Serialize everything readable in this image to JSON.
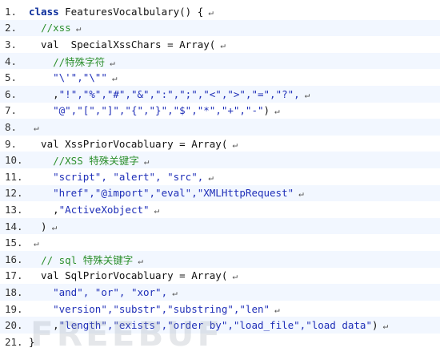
{
  "watermark": "FREEBUF",
  "return_glyph": "↵",
  "lines": [
    {
      "num": "1.",
      "tokens": [
        {
          "t": "kw",
          "v": "class "
        },
        {
          "t": "txt",
          "v": "FeaturesVocalbulary() {"
        }
      ]
    },
    {
      "num": "2.",
      "tokens": [
        {
          "t": "txt",
          "v": "  "
        },
        {
          "t": "cmt",
          "v": "//xss"
        }
      ]
    },
    {
      "num": "3.",
      "tokens": [
        {
          "t": "txt",
          "v": "  val  SpecialXssChars = Array("
        }
      ]
    },
    {
      "num": "4.",
      "tokens": [
        {
          "t": "txt",
          "v": "    "
        },
        {
          "t": "cmt",
          "v": "//特殊字符"
        }
      ]
    },
    {
      "num": "5.",
      "tokens": [
        {
          "t": "txt",
          "v": "    "
        },
        {
          "t": "str",
          "v": "\"\\'\",\"\\\"\""
        }
      ]
    },
    {
      "num": "6.",
      "tokens": [
        {
          "t": "txt",
          "v": "    ,"
        },
        {
          "t": "str",
          "v": "\"!\",\"%\",\"#\",\"&\",\":\",\";\",\"<\",\">\",\"=\",\"?\","
        }
      ]
    },
    {
      "num": "7.",
      "tokens": [
        {
          "t": "txt",
          "v": "    "
        },
        {
          "t": "str",
          "v": "\"@\",\"[\",\"]\",\"{\",\"}\",\"$\",\"*\",\"+\",\"-\""
        },
        {
          "t": "txt",
          "v": ")"
        }
      ]
    },
    {
      "num": "8.",
      "tokens": []
    },
    {
      "num": "9.",
      "tokens": [
        {
          "t": "txt",
          "v": "  val XssPriorVocabluary = Array("
        }
      ]
    },
    {
      "num": "10.",
      "tokens": [
        {
          "t": "txt",
          "v": "    "
        },
        {
          "t": "cmt",
          "v": "//XSS 特殊关键字"
        }
      ]
    },
    {
      "num": "11.",
      "tokens": [
        {
          "t": "txt",
          "v": "    "
        },
        {
          "t": "str",
          "v": "\"script\", \"alert\", \"src\","
        }
      ]
    },
    {
      "num": "12.",
      "tokens": [
        {
          "t": "txt",
          "v": "    "
        },
        {
          "t": "str",
          "v": "\"href\",\"@import\",\"eval\",\"XMLHttpRequest\""
        }
      ]
    },
    {
      "num": "13.",
      "tokens": [
        {
          "t": "txt",
          "v": "    ,"
        },
        {
          "t": "str",
          "v": "\"ActiveXobject\""
        }
      ]
    },
    {
      "num": "14.",
      "tokens": [
        {
          "t": "txt",
          "v": "  )"
        }
      ]
    },
    {
      "num": "15.",
      "tokens": []
    },
    {
      "num": "16.",
      "tokens": [
        {
          "t": "txt",
          "v": "  "
        },
        {
          "t": "cmt",
          "v": "// sql 特殊关键字"
        }
      ]
    },
    {
      "num": "17.",
      "tokens": [
        {
          "t": "txt",
          "v": "  val SqlPriorVocabluary = Array("
        }
      ]
    },
    {
      "num": "18.",
      "tokens": [
        {
          "t": "txt",
          "v": "    "
        },
        {
          "t": "str",
          "v": "\"and\", \"or\", \"xor\","
        }
      ]
    },
    {
      "num": "19.",
      "tokens": [
        {
          "t": "txt",
          "v": "    "
        },
        {
          "t": "str",
          "v": "\"version\",\"substr\",\"substring\",\"len\""
        }
      ]
    },
    {
      "num": "20.",
      "tokens": [
        {
          "t": "txt",
          "v": "    ,"
        },
        {
          "t": "str",
          "v": "\"length\",\"exists\",\"order by\",\"load_file\",\"load data\""
        },
        {
          "t": "txt",
          "v": ")"
        }
      ]
    },
    {
      "num": "21.",
      "tokens": [
        {
          "t": "txt",
          "v": "}"
        }
      ]
    }
  ]
}
